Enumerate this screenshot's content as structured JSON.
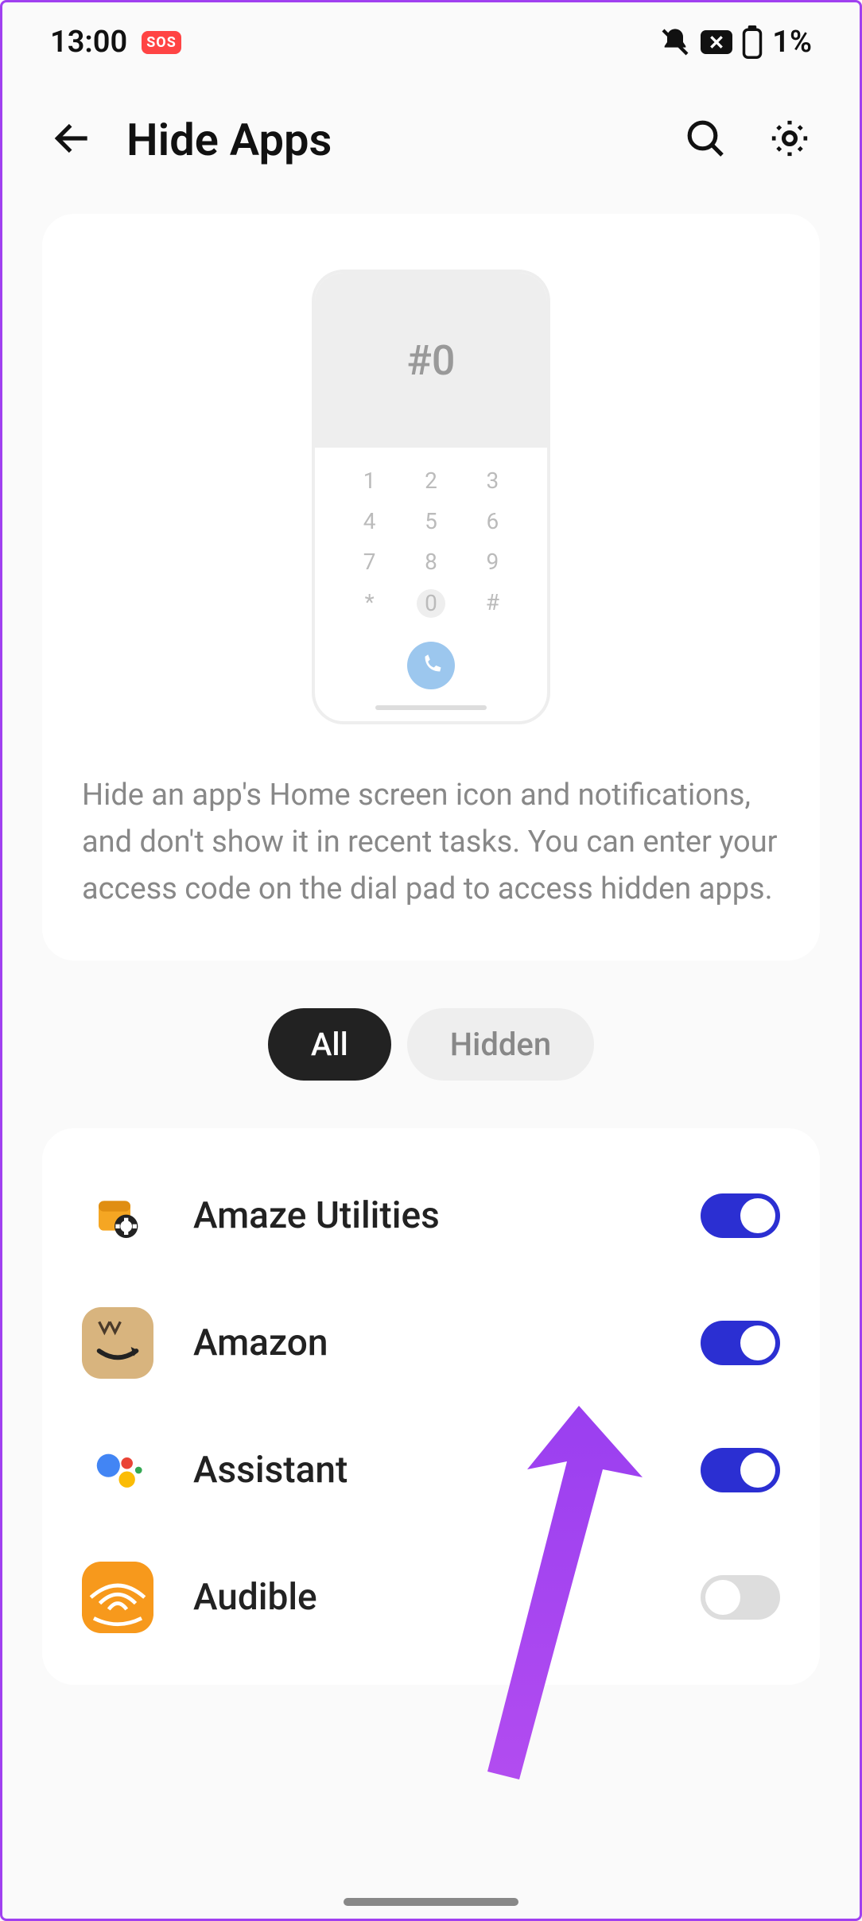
{
  "status": {
    "time": "13:00",
    "sos": "SOS",
    "battery": "1%"
  },
  "header": {
    "title": "Hide Apps"
  },
  "info": {
    "code": "#0",
    "text": "Hide an app's Home screen icon and notifications, and don't show it in recent tasks. You can enter your access code on the dial pad to access hidden apps."
  },
  "tabs": {
    "all": "All",
    "hidden": "Hidden"
  },
  "apps": [
    {
      "name": "Amaze Utilities",
      "toggle": true
    },
    {
      "name": "Amazon",
      "toggle": true
    },
    {
      "name": "Assistant",
      "toggle": true
    },
    {
      "name": "Audible",
      "toggle": false
    }
  ]
}
